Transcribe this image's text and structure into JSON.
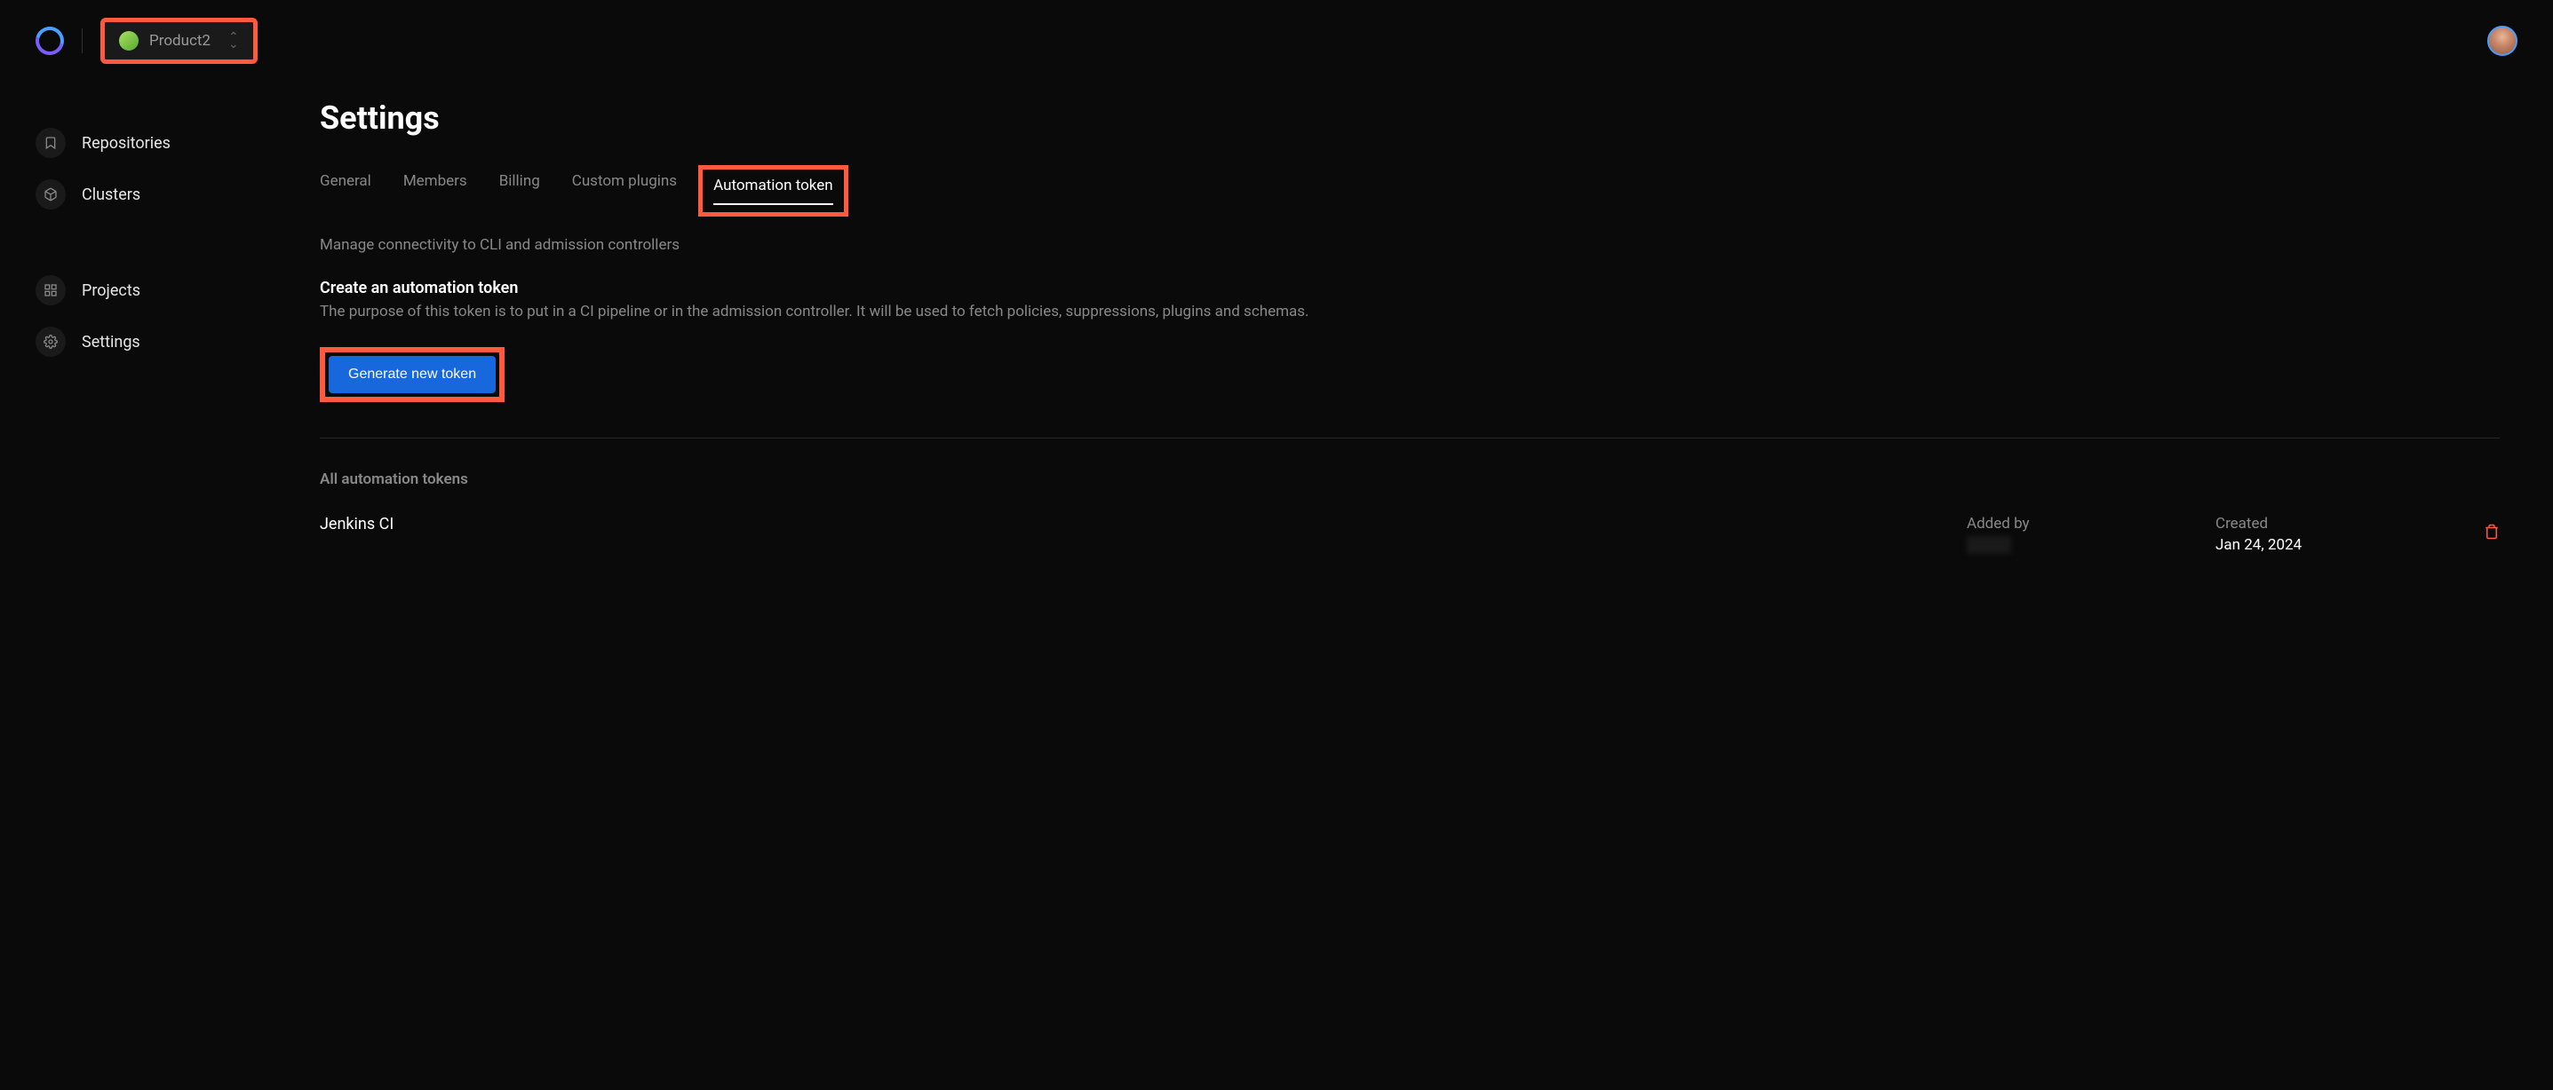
{
  "header": {
    "product_name": "Product2"
  },
  "sidebar": {
    "group1": [
      {
        "label": "Repositories",
        "icon": "bookmark"
      },
      {
        "label": "Clusters",
        "icon": "cube"
      }
    ],
    "group2": [
      {
        "label": "Projects",
        "icon": "grid"
      },
      {
        "label": "Settings",
        "icon": "gear"
      }
    ]
  },
  "page": {
    "title": "Settings",
    "tabs": [
      {
        "label": "General",
        "active": false
      },
      {
        "label": "Members",
        "active": false
      },
      {
        "label": "Billing",
        "active": false
      },
      {
        "label": "Custom plugins",
        "active": false
      },
      {
        "label": "Automation token",
        "active": true
      }
    ],
    "subtitle": "Manage connectivity to CLI and admission controllers",
    "create_section": {
      "heading": "Create an automation token",
      "description": "The purpose of this token is to put in a CI pipeline or in the admission controller. It will be used to fetch policies, suppressions, plugins and schemas.",
      "button_label": "Generate new token"
    },
    "tokens_list": {
      "heading": "All automation tokens",
      "items": [
        {
          "name": "Jenkins CI",
          "added_by_label": "Added by",
          "added_by_value": "",
          "created_label": "Created",
          "created_value": "Jan 24, 2024"
        }
      ]
    }
  }
}
